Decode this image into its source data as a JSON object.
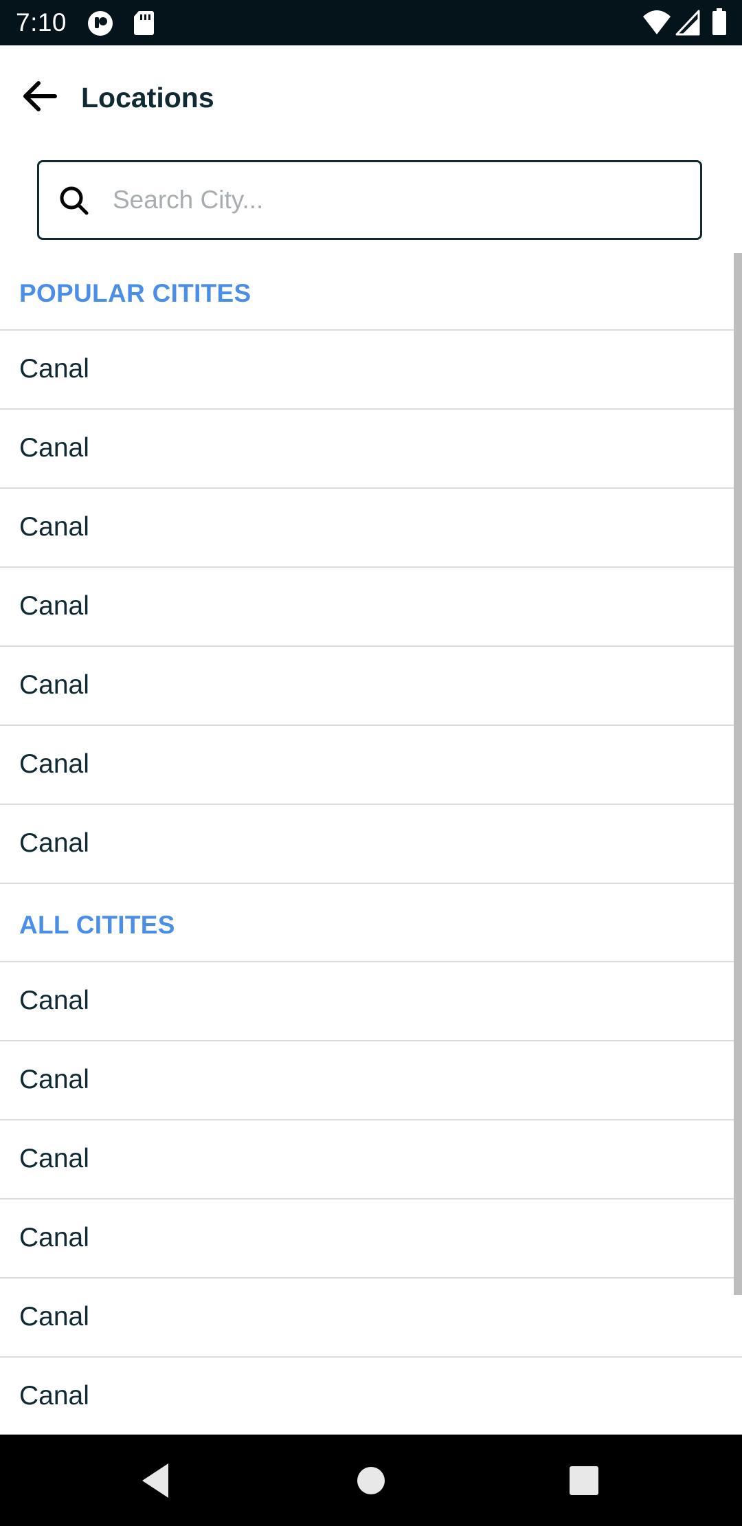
{
  "status_bar": {
    "time": "7:10",
    "left_icons": [
      "app-notification-icon",
      "sd-card-icon"
    ],
    "right_icons": [
      "wifi-icon",
      "cellular-signal-icon",
      "battery-icon"
    ]
  },
  "header": {
    "title": "Locations",
    "back_icon": "arrow-left-icon"
  },
  "search": {
    "placeholder": "Search City...",
    "value": ""
  },
  "sections": [
    {
      "title": "POPULAR CITITES",
      "items": [
        "Canal",
        "Canal",
        "Canal",
        "Canal",
        "Canal",
        "Canal",
        "Canal"
      ]
    },
    {
      "title": "ALL CITITES",
      "items": [
        "Canal",
        "Canal",
        "Canal",
        "Canal",
        "Canal",
        "Canal"
      ]
    }
  ],
  "nav_bar": {
    "buttons": [
      "back-triangle-icon",
      "home-circle-icon",
      "recents-square-icon"
    ]
  },
  "colors": {
    "status_bar_bg": "#04141a",
    "accent": "#4a8ee8",
    "text": "#0f2a33",
    "divider": "#dcdcdc",
    "placeholder": "#a7adb0",
    "nav_bar_bg": "#000000"
  }
}
